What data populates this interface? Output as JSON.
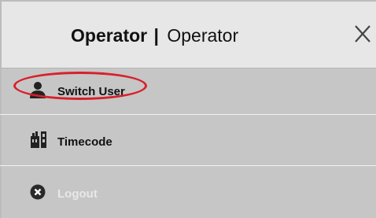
{
  "header": {
    "title_bold": "Operator",
    "separator": "|",
    "title_regular": "Operator",
    "close_icon": "close-icon"
  },
  "menu": {
    "items": [
      {
        "label": "Switch User",
        "icon": "user-icon",
        "enabled": true
      },
      {
        "label": "Timecode",
        "icon": "timecode-icon",
        "enabled": true
      },
      {
        "label": "Logout",
        "icon": "logout-icon",
        "enabled": false
      }
    ]
  },
  "annotation": {
    "highlight_color": "#d8202a"
  }
}
